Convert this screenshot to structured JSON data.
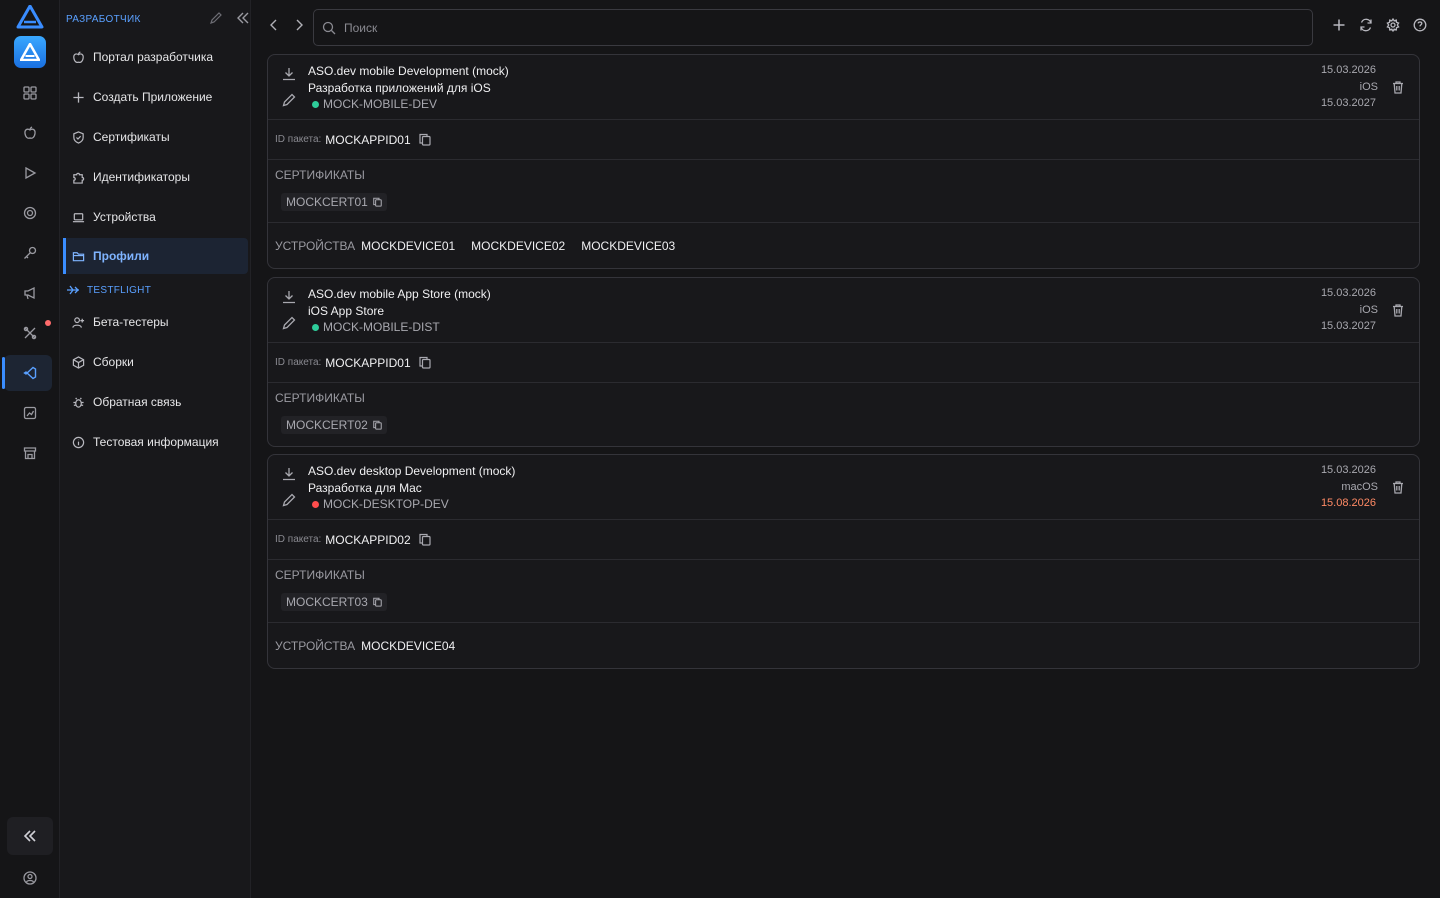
{
  "sidebar": {
    "section_title": "РАЗРАБОТЧИК",
    "items": [
      {
        "label": "Портал разработчика",
        "icon": "apple-icon"
      },
      {
        "label": "Создать Приложение",
        "icon": "plus-icon"
      },
      {
        "label": "Сертификаты",
        "icon": "shield-check-icon"
      },
      {
        "label": "Идентификаторы",
        "icon": "puzzle-icon"
      },
      {
        "label": "Устройства",
        "icon": "laptop-icon"
      },
      {
        "label": "Профили",
        "icon": "folder-icon",
        "active": true
      }
    ],
    "testflight_title": "TESTFLIGHT",
    "testflight_items": [
      {
        "label": "Бета-тестеры",
        "icon": "user-plus-icon"
      },
      {
        "label": "Сборки",
        "icon": "box-icon"
      },
      {
        "label": "Обратная связь",
        "icon": "bug-icon"
      },
      {
        "label": "Тестовая информация",
        "icon": "info-icon"
      }
    ]
  },
  "search": {
    "placeholder": "Поиск"
  },
  "labels": {
    "package_id": "ID пакета:",
    "certificates": "СЕРТИФИКАТЫ",
    "devices": "УСТРОЙСТВА"
  },
  "profiles": [
    {
      "title": "ASO.dev mobile Development (mock)",
      "subtitle": "Разработка приложений для iOS",
      "profile_name": "MOCK-MOBILE-DEV",
      "status_color": "#2ecc9a",
      "created": "15.03.2026",
      "platform": "iOS",
      "expires": "15.03.2027",
      "package_id": "MOCKAPPID01",
      "certificates": [
        "MOCKCERT01"
      ],
      "devices": [
        "MOCKDEVICE01",
        "MOCKDEVICE02",
        "MOCKDEVICE03"
      ]
    },
    {
      "title": "ASO.dev mobile App Store (mock)",
      "subtitle": "iOS App Store",
      "profile_name": "MOCK-MOBILE-DIST",
      "status_color": "#2ecc9a",
      "created": "15.03.2026",
      "platform": "iOS",
      "expires": "15.03.2027",
      "package_id": "MOCKAPPID01",
      "certificates": [
        "MOCKCERT02"
      ],
      "devices": []
    },
    {
      "title": "ASO.dev desktop Development (mock)",
      "subtitle": "Разработка для Mac",
      "profile_name": "MOCK-DESKTOP-DEV",
      "status_color": "#ff4d4d",
      "created": "15.03.2026",
      "platform": "macOS",
      "expires": "15.08.2026",
      "expires_color": "#ff8a65",
      "package_id": "MOCKAPPID02",
      "certificates": [
        "MOCKCERT03"
      ],
      "devices": [
        "MOCKDEVICE04"
      ]
    }
  ],
  "colors": {
    "accent": "#3a8dff",
    "background": "#151517",
    "expiring": "#ff8a65"
  }
}
